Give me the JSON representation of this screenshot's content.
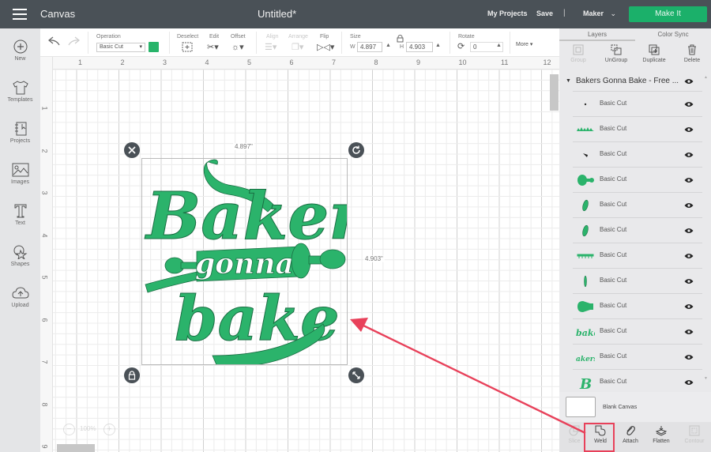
{
  "header": {
    "menu_icon": "hamburger-menu-icon",
    "app_title": "Canvas",
    "document_title": "Untitled*",
    "my_projects": "My Projects",
    "save": "Save",
    "separator": "|",
    "machine": "Maker",
    "make_it": "Make It"
  },
  "sidebar": {
    "items": [
      {
        "label": "New",
        "icon": "plus-circle-icon"
      },
      {
        "label": "Templates",
        "icon": "tshirt-icon"
      },
      {
        "label": "Projects",
        "icon": "notebook-icon"
      },
      {
        "label": "Images",
        "icon": "image-icon"
      },
      {
        "label": "Text",
        "icon": "text-t-icon"
      },
      {
        "label": "Shapes",
        "icon": "shapes-icon"
      },
      {
        "label": "Upload",
        "icon": "cloud-upload-icon"
      }
    ]
  },
  "toolbar": {
    "operation_label": "Operation",
    "operation_value": "Basic Cut",
    "operation_color": "#28b46a",
    "deselect": "Deselect",
    "edit": "Edit",
    "offset": "Offset",
    "align": "Align",
    "arrange": "Arrange",
    "flip": "Flip",
    "size_label": "Size",
    "w_label": "W",
    "w_value": "4.897",
    "h_label": "H",
    "h_value": "4.903",
    "rotate_label": "Rotate",
    "rotate_value": "0",
    "more": "More"
  },
  "canvas": {
    "ruler_top": [
      "1",
      "2",
      "3",
      "4",
      "5",
      "6",
      "7",
      "8",
      "9",
      "10",
      "11",
      "12"
    ],
    "ruler_left": [
      "1",
      "2",
      "3",
      "4",
      "5",
      "6",
      "7",
      "8",
      "9"
    ],
    "width_dim": "4.897\"",
    "height_dim": "4.903\"",
    "zoom_value": "100%",
    "artwork_lines": [
      "Bakers",
      "gonna",
      "bake"
    ],
    "artwork_color": "#2bb36b"
  },
  "layers_panel": {
    "tabs": [
      "Layers",
      "Color Sync"
    ],
    "tools": [
      "Group",
      "UnGroup",
      "Duplicate",
      "Delete"
    ],
    "group_name": "Bakers Gonna Bake - Free ...",
    "layers": [
      {
        "name": "Basic Cut",
        "thumb": "dot"
      },
      {
        "name": "Basic Cut",
        "thumb": "grass"
      },
      {
        "name": "Basic Cut",
        "thumb": "wedge"
      },
      {
        "name": "Basic Cut",
        "thumb": "rolling-pin-handle"
      },
      {
        "name": "Basic Cut",
        "thumb": "leaf"
      },
      {
        "name": "Basic Cut",
        "thumb": "leaf"
      },
      {
        "name": "Basic Cut",
        "thumb": "comb"
      },
      {
        "name": "Basic Cut",
        "thumb": "sliver"
      },
      {
        "name": "Basic Cut",
        "thumb": "rolling-pin-end"
      },
      {
        "name": "Basic Cut",
        "thumb": "bake-text"
      },
      {
        "name": "Basic Cut",
        "thumb": "akers-text"
      },
      {
        "name": "Basic Cut",
        "thumb": "letter-b"
      }
    ],
    "blank_canvas": "Blank Canvas",
    "bottom_tools": [
      "Slice",
      "Weld",
      "Attach",
      "Flatten",
      "Contour"
    ],
    "highlighted_tool": "Weld",
    "annotation_color": "#e8415a"
  }
}
